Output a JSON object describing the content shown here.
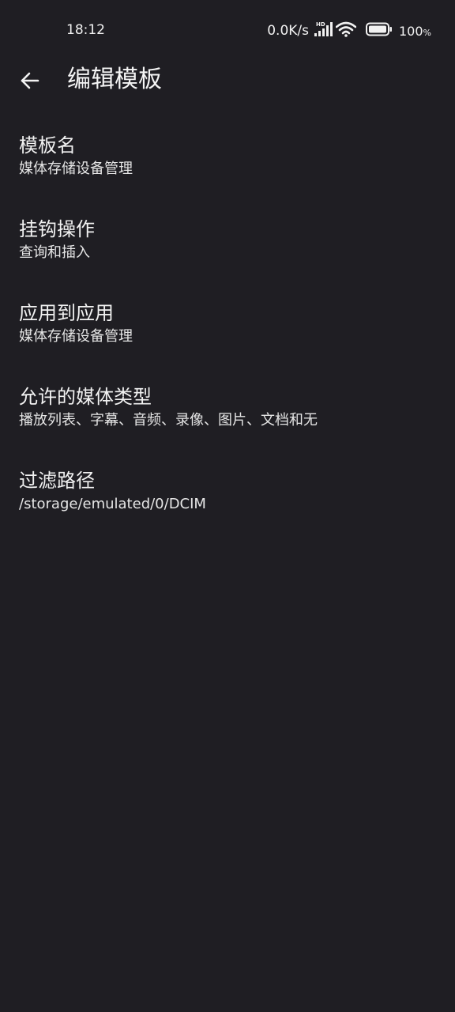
{
  "status_bar": {
    "time": "18:12",
    "net_speed": "0.0K/s",
    "signal_badge": "HD",
    "battery_percent": "100",
    "battery_percent_sign": "%"
  },
  "header": {
    "title": "编辑模板",
    "back_icon": "arrow-left-icon"
  },
  "settings": [
    {
      "title": "模板名",
      "summary": "媒体存储设备管理"
    },
    {
      "title": "挂钩操作",
      "summary": "查询和插入"
    },
    {
      "title": "应用到应用",
      "summary": "媒体存储设备管理"
    },
    {
      "title": "允许的媒体类型",
      "summary": "播放列表、字幕、音频、录像、图片、文档和无"
    },
    {
      "title": "过滤路径",
      "summary": "/storage/emulated/0/DCIM"
    }
  ],
  "colors": {
    "background": "#1f1e23",
    "text_primary": "#f2f2f2",
    "text_secondary": "#e6e6e6"
  }
}
